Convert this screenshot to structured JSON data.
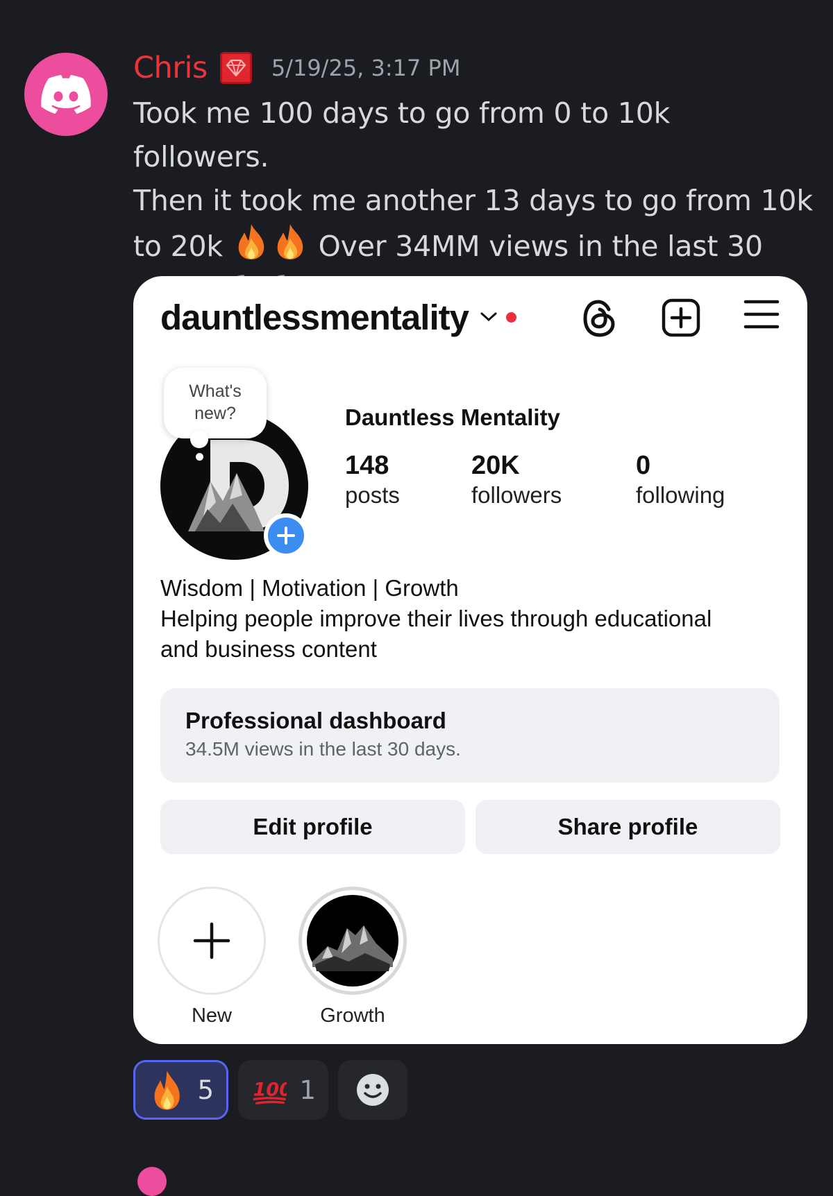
{
  "message": {
    "username": "Chris",
    "timestamp": "5/19/25, 3:17 PM",
    "avatar_icon": "discord-logo-icon",
    "badge_icon": "ruby-gem-icon",
    "line1": "Took me 100 days to go from 0 to 10k followers.",
    "line2": "Then it took me another 13 days to go from 10k",
    "line3a": "to 20k",
    "line3b": "Over 34MM views in the last 30",
    "line4": "days",
    "colors": {
      "username": "#e9343b",
      "avatar": "#ec4d9c"
    }
  },
  "profile": {
    "handle": "dauntlessmentality",
    "bubble_line1": "What's",
    "bubble_line2": "new?",
    "display_name": "Dauntless Mentality",
    "stats": [
      {
        "num": "148",
        "label": "posts"
      },
      {
        "num": "20K",
        "label": "followers"
      },
      {
        "num": "0",
        "label": "following"
      }
    ],
    "bio_line1": "Wisdom | Motivation | Growth",
    "bio_line2": "Helping people improve their lives through educational",
    "bio_line3": "and business content",
    "dashboard_title": "Professional dashboard",
    "dashboard_sub": "34.5M views in the last 30 days.",
    "edit_label": "Edit profile",
    "share_label": "Share profile",
    "highlights": [
      {
        "label": "New"
      },
      {
        "label": "Growth"
      }
    ]
  },
  "reactions": [
    {
      "emoji": "fire-emoji",
      "count": "5"
    },
    {
      "emoji": "hundred-emoji",
      "count": "1"
    },
    {
      "emoji": "add-reaction-icon"
    }
  ]
}
